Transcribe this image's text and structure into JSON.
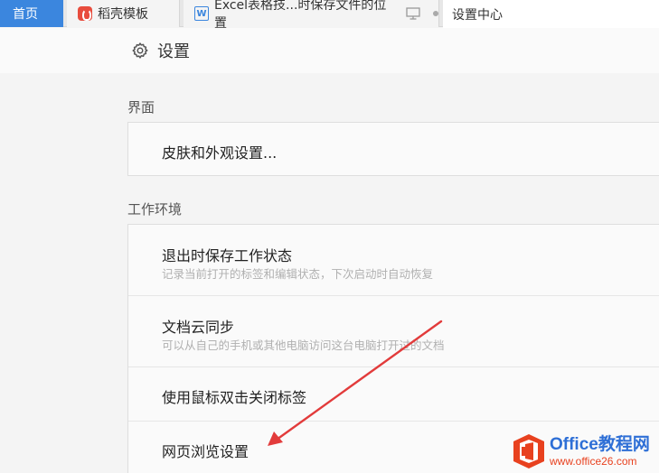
{
  "tabs": {
    "home": "首页",
    "daoke": "稻壳模板",
    "doc": "Excel表格技...时保存文件的位置",
    "settings": "设置中心"
  },
  "header": {
    "title": "设置"
  },
  "sections": {
    "interface": {
      "heading": "界面",
      "items": [
        {
          "title": "皮肤和外观设置..."
        }
      ]
    },
    "work_env": {
      "heading": "工作环境",
      "items": [
        {
          "title": "退出时保存工作状态",
          "desc": "记录当前打开的标签和编辑状态，下次启动时自动恢复"
        },
        {
          "title": "文档云同步",
          "desc": "可以从自己的手机或其他电脑访问这台电脑打开过的文档"
        },
        {
          "title": "使用鼠标双击关闭标签"
        },
        {
          "title": "网页浏览设置"
        }
      ]
    }
  },
  "watermark": {
    "brand": "Office教程网",
    "url": "www.office26.com"
  },
  "colors": {
    "accent": "#3b86de",
    "arrow": "#e23b3b",
    "brand_blue": "#2e6fd6",
    "brand_orange": "#e8411f"
  },
  "icons": [
    "gear-icon",
    "monitor-icon",
    "daoke-logo-icon",
    "w-logo-icon",
    "office-logo-icon",
    "arrow-annotation"
  ]
}
